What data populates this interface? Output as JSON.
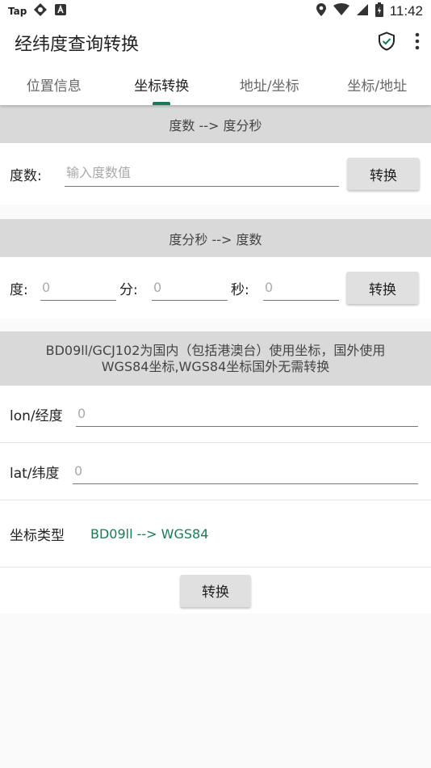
{
  "status_bar": {
    "left_text": "Tap",
    "time": "11:42",
    "icons": [
      "location-icon",
      "wifi-icon",
      "cell-signal-icon",
      "battery-icon"
    ]
  },
  "app": {
    "title": "经纬度查询转换",
    "icons": [
      "shield-check-icon",
      "more-vert-icon"
    ],
    "accent_color": "#1a7a55"
  },
  "tabs": [
    {
      "label": "位置信息",
      "active": false
    },
    {
      "label": "坐标转换",
      "active": true
    },
    {
      "label": "地址/坐标",
      "active": false
    },
    {
      "label": "坐标/地址",
      "active": false
    }
  ],
  "deg_to_dms": {
    "header": "度数 --> 度分秒",
    "label": "度数:",
    "placeholder": "输入度数值",
    "button": "转换"
  },
  "dms_to_deg": {
    "header": "度分秒 --> 度数",
    "deg_label": "度:",
    "deg_placeholder": "0",
    "min_label": "分:",
    "min_placeholder": "0",
    "sec_label": "秒:",
    "sec_placeholder": "0",
    "button": "转换"
  },
  "coord_convert": {
    "header_line1": "BD09ll/GCJ102为国内（包括港澳台）使用坐标，国外使用",
    "header_line2": "WGS84坐标,WGS84坐标国外无需转换",
    "lon_label": "lon/经度",
    "lon_placeholder": "0",
    "lat_label": "lat/纬度",
    "lat_placeholder": "0",
    "type_label": "坐标类型",
    "type_value": "BD09ll --> WGS84",
    "button": "转换"
  }
}
